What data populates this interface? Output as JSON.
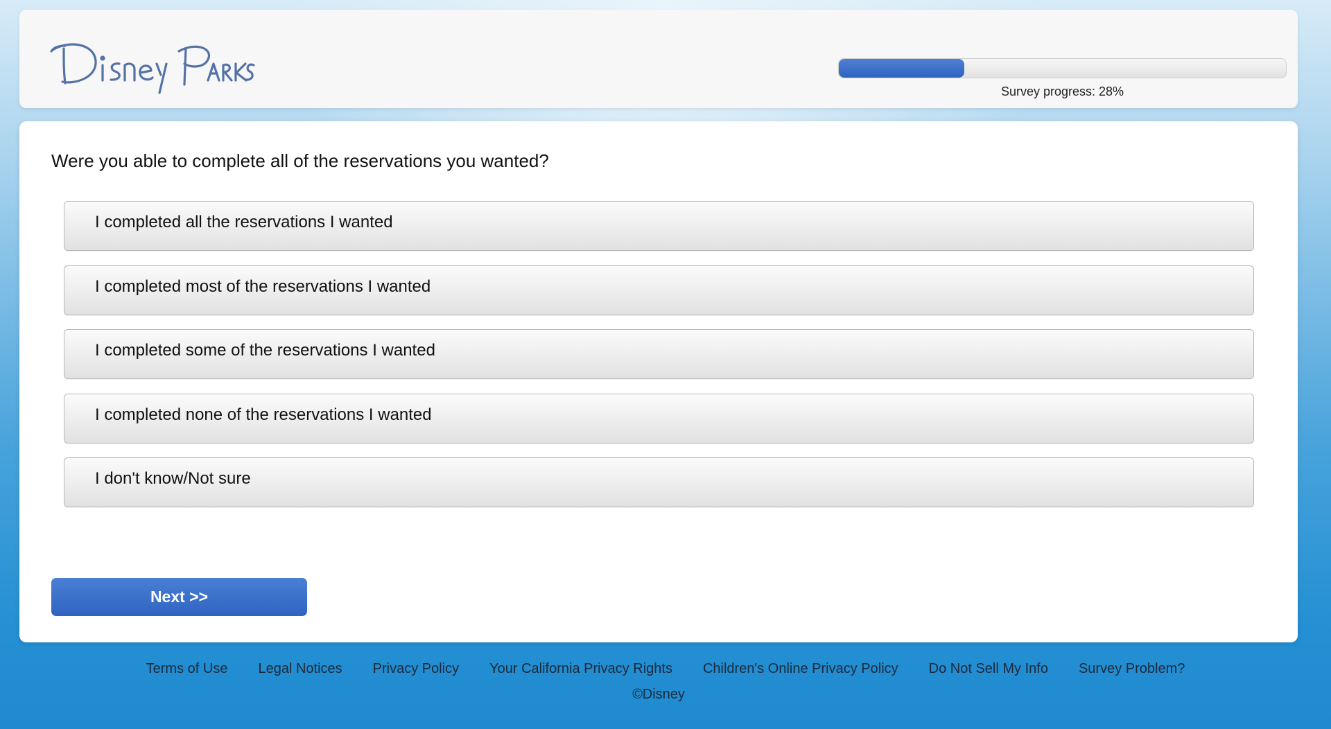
{
  "header": {
    "logo_text": "Disney Parks",
    "progress_label": "Survey progress: 28%",
    "progress_percent": 28
  },
  "question": {
    "text": "Were you able to complete all of the reservations you wanted?",
    "options": [
      "I completed all the reservations I wanted",
      "I completed most of the reservations I wanted",
      "I completed some of the reservations I wanted",
      "I completed none of the reservations I wanted",
      "I don't know/Not sure"
    ]
  },
  "actions": {
    "next_label": "Next >>"
  },
  "footer": {
    "links": [
      "Terms of Use",
      "Legal Notices",
      "Privacy Policy",
      "Your California Privacy Rights",
      "Children's Online Privacy Policy",
      "Do Not Sell My Info",
      "Survey Problem?"
    ],
    "copyright": "©Disney"
  },
  "colors": {
    "brand_blue": "#2f64c2",
    "logo_blue": "#4a6fa8",
    "background_blue": "#2590d3"
  }
}
